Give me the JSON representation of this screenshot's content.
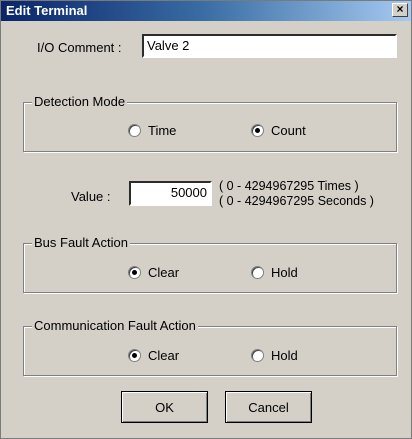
{
  "window": {
    "title": "Edit Terminal",
    "close_glyph": "×"
  },
  "io_comment": {
    "label": "I/O Comment :",
    "value": "Valve 2"
  },
  "detection_mode": {
    "caption": "Detection Mode",
    "options": [
      {
        "label": "Time",
        "checked": false
      },
      {
        "label": "Count",
        "checked": true
      }
    ]
  },
  "value_field": {
    "label": "Value :",
    "value": "50000",
    "range_times": "( 0 - 4294967295 Times )",
    "range_seconds": "( 0 - 4294967295 Seconds )"
  },
  "bus_fault": {
    "caption": "Bus Fault Action",
    "options": [
      {
        "label": "Clear",
        "checked": true
      },
      {
        "label": "Hold",
        "checked": false
      }
    ]
  },
  "comm_fault": {
    "caption": "Communication Fault Action",
    "options": [
      {
        "label": "Clear",
        "checked": true
      },
      {
        "label": "Hold",
        "checked": false
      }
    ]
  },
  "buttons": {
    "ok": "OK",
    "cancel": "Cancel"
  },
  "colors": {
    "titlebar_start": "#0a246a",
    "titlebar_end": "#a6caf0",
    "face": "#d4d0c8"
  }
}
